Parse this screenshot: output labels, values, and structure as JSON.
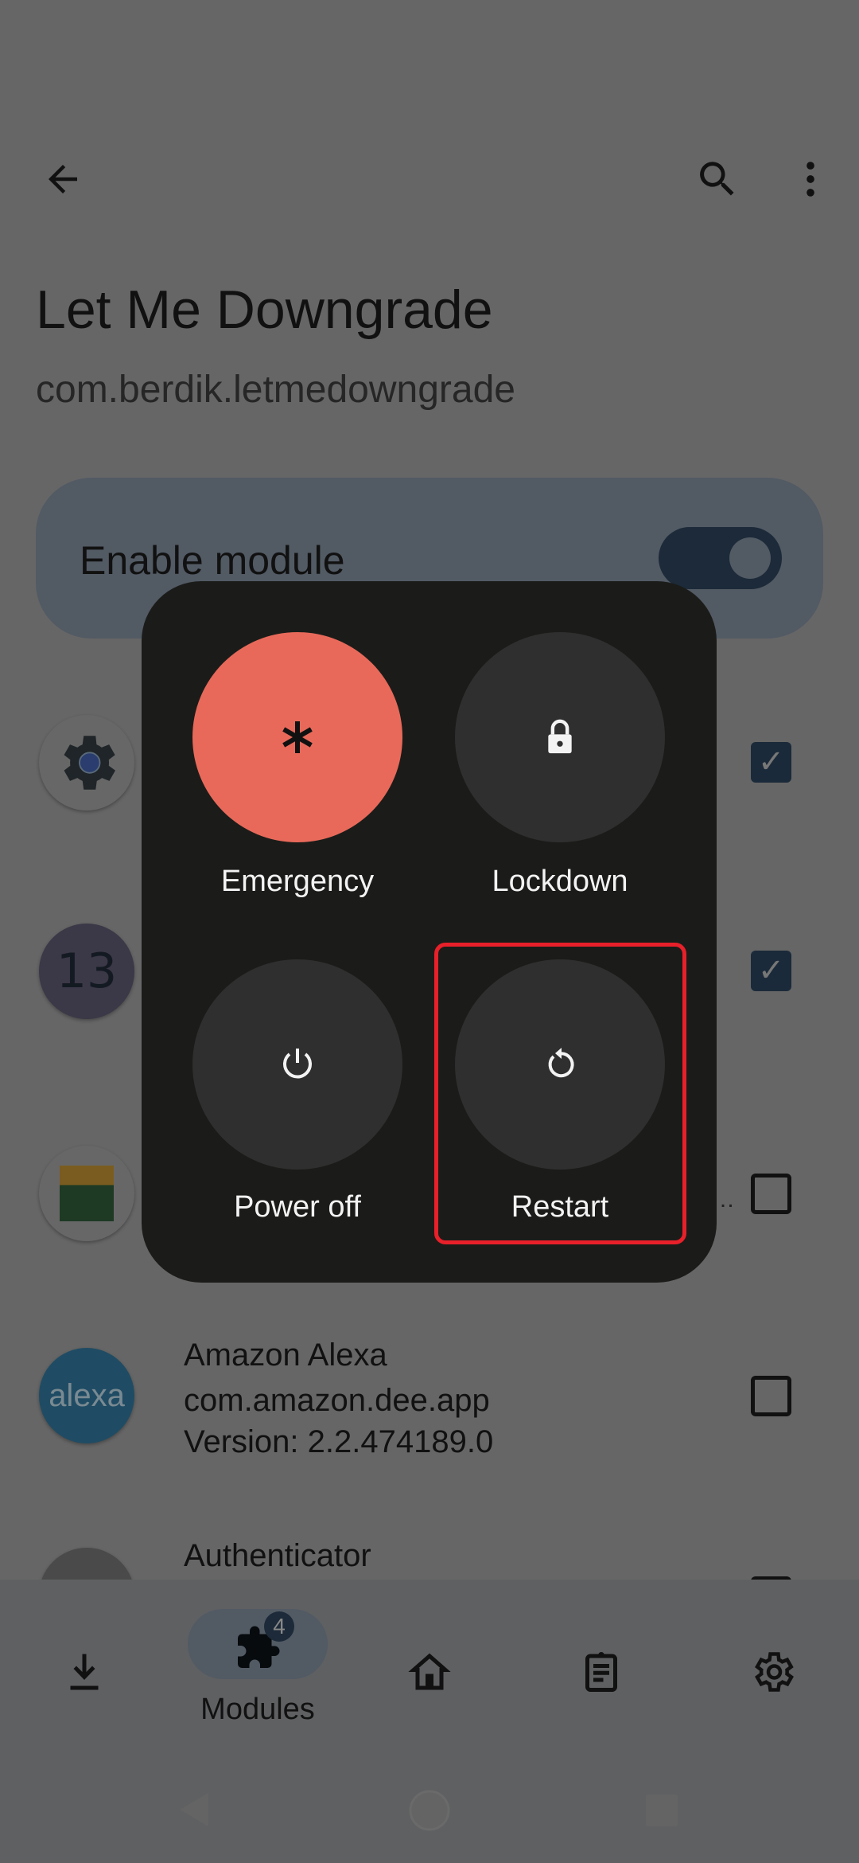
{
  "toolbar": {
    "back": "arrow-back-icon",
    "search": "search-icon",
    "more": "more-vert-icon"
  },
  "header": {
    "title": "Let Me Downgrade",
    "package": "com.berdik.letmedowngrade"
  },
  "enable_card": {
    "label": "Enable module",
    "enabled": true
  },
  "apps": [
    {
      "icon": "android-system-icon",
      "checked": true
    },
    {
      "icon": "android-13-icon",
      "label": "13",
      "checked": true
    },
    {
      "icon": "hiker-app-icon",
      "checked": false
    },
    {
      "icon": "alexa-icon",
      "label": "alexa",
      "name": "Amazon Alexa",
      "package": "com.amazon.dee.app",
      "version": "Version: 2.2.474189.0",
      "checked": false
    },
    {
      "icon": "authenticator-icon",
      "name": "Authenticator",
      "checked": false
    }
  ],
  "ellipsis": "…",
  "bottom_nav": {
    "active": "Modules",
    "items": [
      "download-icon",
      "modules-icon",
      "home-icon",
      "logs-icon",
      "settings-icon"
    ],
    "modules_label": "Modules",
    "badge": "4"
  },
  "power_menu": {
    "emergency": "Emergency",
    "lockdown": "Lockdown",
    "power_off": "Power off",
    "restart": "Restart",
    "emergency_color": "#e8695a",
    "highlight_color": "#e8202a"
  }
}
